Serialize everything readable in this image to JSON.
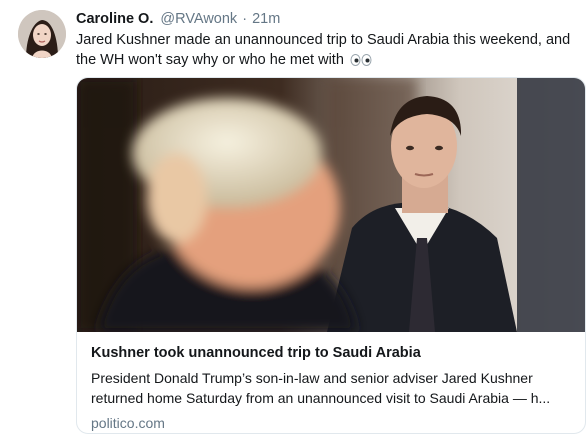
{
  "tweet": {
    "author_name": "Caroline O.",
    "handle": "@RVAwonk",
    "separator": "·",
    "time": "21m",
    "text": "Jared Kushner made an unannounced trip to Saudi Arabia this weekend, and the WH won't say why or who he met with",
    "emoji_icon": "eyes-emoji-icon"
  },
  "card": {
    "title": "Kushner took unannounced trip to Saudi Arabia",
    "description": "President Donald Trump’s son-in-law and senior adviser Jared Kushner returned home Saturday from an unannounced visit to Saudi Arabia — h...",
    "domain": "politico.com"
  },
  "colors": {
    "text_primary": "#14171a",
    "text_secondary": "#657786",
    "card_border": "#e1e8ed"
  }
}
